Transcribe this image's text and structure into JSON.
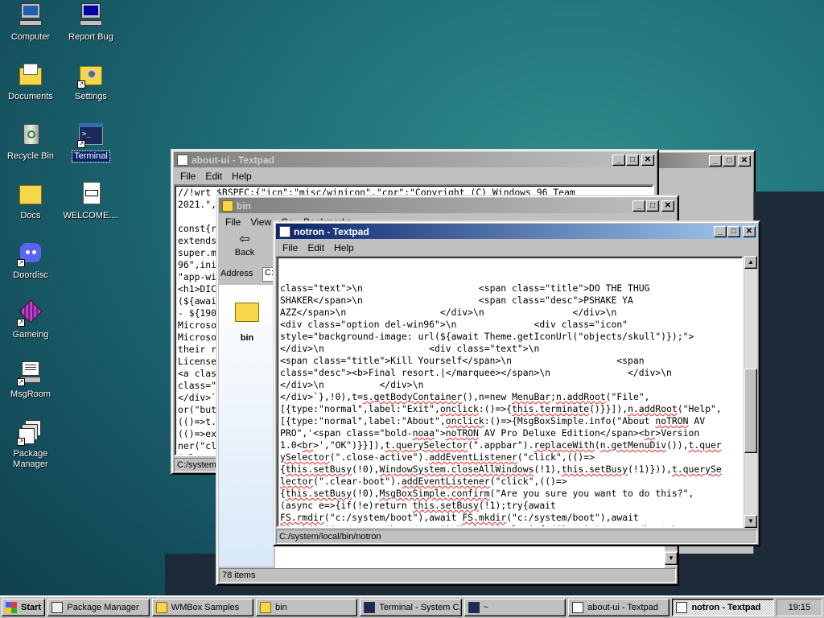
{
  "desktop": {
    "icons": [
      {
        "label": "Computer",
        "icon": "computer-icon"
      },
      {
        "label": "Report Bug",
        "icon": "report-bug-icon"
      },
      {
        "label": "Documents",
        "icon": "documents-icon"
      },
      {
        "label": "Settings",
        "icon": "settings-icon"
      },
      {
        "label": "Recycle Bin",
        "icon": "recycle-bin-icon"
      },
      {
        "label": "Terminal",
        "icon": "terminal-icon"
      },
      {
        "label": "Docs",
        "icon": "folder-icon"
      },
      {
        "label": "WELCOME....",
        "icon": "markdown-file-icon"
      },
      {
        "label": "Doordisc",
        "icon": "doordisc-icon"
      },
      {
        "label": "Gameing",
        "icon": "gameing-icon"
      },
      {
        "label": "MsgRoom",
        "icon": "msgroom-icon"
      },
      {
        "label": "Package Manager",
        "icon": "package-manager-icon"
      }
    ]
  },
  "windows": {
    "about_ui": {
      "title": "about-ui - Textpad",
      "menu": [
        "File",
        "Edit",
        "Help"
      ],
      "lines": [
        "//!wrt $BSPEC:{\"icn\":\"misc/winicon\",\"cpr\":\"Copyright (C) Windows 96 Team",
        "2021.\",",
        "",
        "const{r",
        "extends",
        "super.m",
        "96\",ini",
        "\"app-wi",
        "<h1>DIC",
        "(${awai",
        "- ${190",
        "Microso",
        "Microso",
        "their r",
        "License",
        "<a clas",
        "class=\"",
        "</div>`",
        "or(\"but",
        "(()=>t.",
        "(()=>ex",
        "ner(\"cl",
        "\"class"
      ],
      "status": "C:/system/"
    },
    "behind_window": {
      "title": ""
    },
    "bin": {
      "title": "bin",
      "menu": [
        "File",
        "View",
        "Go",
        "Bookmarks"
      ],
      "back_label": "Back",
      "address_label": "Address",
      "address_value": "C:",
      "item_label": "bin",
      "status": "78 items"
    },
    "notron": {
      "title": "notron - Textpad",
      "menu": [
        "File",
        "Edit",
        "Help"
      ],
      "status": "C:/system/local/bin/notron"
    }
  },
  "taskbar": {
    "start_label": "Start",
    "items": [
      {
        "label": "Package Manager",
        "icon": "package-manager-icon"
      },
      {
        "label": "WMBox Samples",
        "icon": "folder-icon"
      },
      {
        "label": "bin",
        "icon": "folder-icon"
      },
      {
        "label": "Terminal - System C...",
        "icon": "terminal-icon"
      },
      {
        "label": "~",
        "icon": "terminal-icon"
      },
      {
        "label": "about-ui - Textpad",
        "icon": "textpad-icon"
      },
      {
        "label": "notron - Textpad",
        "icon": "textpad-icon"
      }
    ],
    "clock": "19:15"
  }
}
